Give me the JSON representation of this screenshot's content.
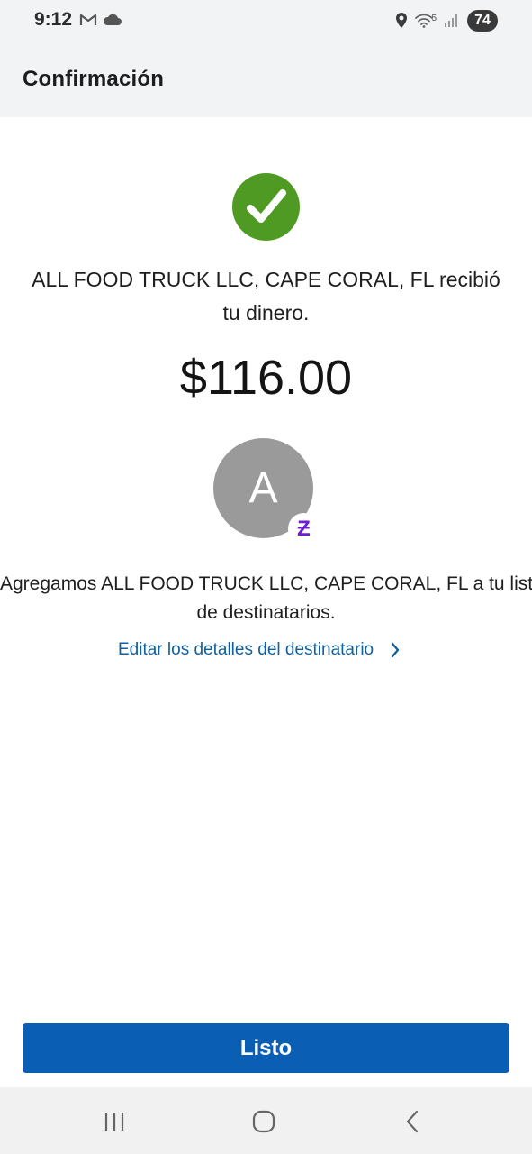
{
  "status_bar": {
    "time": "9:12",
    "battery": "74",
    "network_label": "5",
    "icons": [
      "gmail-icon",
      "cloud-icon",
      "location-icon",
      "wifi-icon",
      "signal-icon",
      "battery-icon"
    ]
  },
  "header": {
    "title": "Confirmación"
  },
  "confirmation": {
    "success_icon": "check-icon",
    "message_line1": "ALL FOOD TRUCK LLC, CAPE CORAL, FL recibió",
    "message_line2": "tu dinero.",
    "amount": "$116.00"
  },
  "recipient": {
    "avatar_initial": "A",
    "badge_symbol": "Ƶ",
    "added_line1": "Agregamos ALL FOOD TRUCK LLC, CAPE CORAL, FL a tu lista",
    "added_line2": "de destinatarios.",
    "edit_link": "Editar los detalles del destinatario"
  },
  "actions": {
    "done_label": "Listo"
  },
  "colors": {
    "success_green": "#4e9a23",
    "primary_blue": "#0a5fb5",
    "link_blue": "#12609c",
    "zelle_purple": "#6d1ed4"
  }
}
